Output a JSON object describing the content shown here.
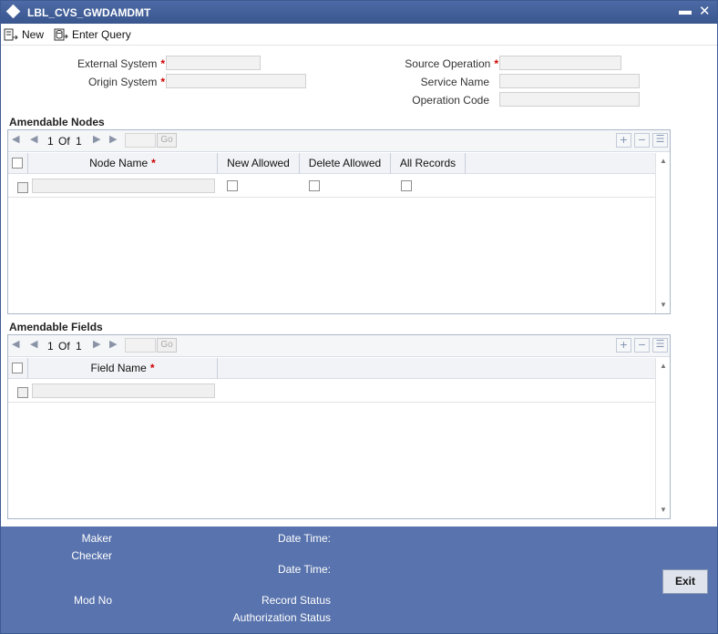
{
  "window": {
    "title": "LBL_CVS_GWDAMDMT"
  },
  "toolbar": {
    "new_label": "New",
    "enter_query_label": "Enter Query"
  },
  "form": {
    "external_system_label": "External System",
    "origin_system_label": "Origin System",
    "source_operation_label": "Source Operation",
    "service_name_label": "Service Name",
    "operation_code_label": "Operation Code",
    "required_mark": "*",
    "external_system_value": "",
    "origin_system_value": "",
    "source_operation_value": "",
    "service_name_value": "",
    "operation_code_value": ""
  },
  "nodes": {
    "title": "Amendable Nodes",
    "page_current": "1",
    "page_of": "Of",
    "page_total": "1",
    "go_label": "Go",
    "columns": [
      "Node Name",
      "New Allowed",
      "Delete Allowed",
      "All Records"
    ],
    "required_mark": "*"
  },
  "fields": {
    "title": "Amendable Fields",
    "page_current": "1",
    "page_of": "Of",
    "page_total": "1",
    "go_label": "Go",
    "columns": [
      "Field Name"
    ],
    "required_mark": "*"
  },
  "footer": {
    "maker_label": "Maker",
    "checker_label": "Checker",
    "mod_no_label": "Mod No",
    "date_time_label_1": "Date Time:",
    "date_time_label_2": "Date Time:",
    "record_status_label": "Record Status",
    "authorization_status_label": "Authorization Status",
    "exit_label": "Exit"
  },
  "colors": {
    "titlebar": "#4d6aa6",
    "footer": "#5873ad",
    "required": "#cc0000"
  }
}
